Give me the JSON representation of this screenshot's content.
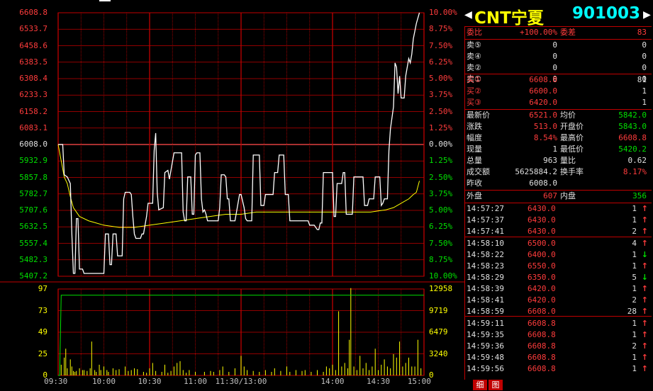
{
  "price_axis": {
    "left_labels": [
      "6608.8",
      "6533.7",
      "6458.6",
      "6383.5",
      "6308.4",
      "6233.3",
      "6158.2",
      "6083.1",
      "6008.0",
      "5932.9",
      "5857.8",
      "5782.7",
      "5707.6",
      "5632.5",
      "5557.4",
      "5482.3",
      "5407.2"
    ],
    "right_labels": [
      "10.00%",
      "8.75%",
      "7.50%",
      "6.25%",
      "5.00%",
      "3.75%",
      "2.50%",
      "1.25%",
      "0.00%",
      "1.25%",
      "2.50%",
      "3.75%",
      "5.00%",
      "6.25%",
      "7.50%",
      "8.75%",
      "10.00%"
    ]
  },
  "volume_axis": {
    "left_labels": [
      "97",
      "73",
      "49",
      "25",
      "0"
    ],
    "right_labels": [
      "12958",
      "9719",
      "6479",
      "3240",
      "0"
    ]
  },
  "time_axis": {
    "labels": [
      "09:30",
      "10:00",
      "10:30",
      "11:00",
      "11:30/13:00",
      "14:00",
      "14:30",
      "15:00"
    ]
  },
  "colors": {
    "up": "#ff3c3c",
    "down": "#00e000",
    "grid": "#c00000",
    "price_line": "#ffffff",
    "avg_line": "#ffff00",
    "neutral": "#e0e0e0",
    "title": "#ffff00",
    "code": "#00ffff"
  },
  "chart_data": {
    "type": "line",
    "title": "",
    "pre_close": 6008.0,
    "ylim": [
      5407.2,
      6608.8
    ],
    "time_domain_minutes": [
      0,
      240
    ],
    "price_series": [
      [
        0,
        6008
      ],
      [
        3,
        6008
      ],
      [
        4,
        5870
      ],
      [
        6,
        5860
      ],
      [
        8,
        5830
      ],
      [
        9,
        5600
      ],
      [
        10,
        5420
      ],
      [
        11,
        5420
      ],
      [
        12,
        5670
      ],
      [
        13,
        5670
      ],
      [
        14,
        5440
      ],
      [
        16,
        5440
      ],
      [
        17,
        5420
      ],
      [
        30,
        5420
      ],
      [
        31,
        5600
      ],
      [
        33,
        5600
      ],
      [
        34,
        5460
      ],
      [
        35,
        5460
      ],
      [
        36,
        5600
      ],
      [
        38,
        5600
      ],
      [
        39,
        5500
      ],
      [
        40,
        5500
      ],
      [
        42,
        5500
      ],
      [
        43,
        5760
      ],
      [
        44,
        5790
      ],
      [
        47,
        5790
      ],
      [
        48,
        5780
      ],
      [
        49,
        5680
      ],
      [
        50,
        5600
      ],
      [
        51,
        5580
      ],
      [
        54,
        5580
      ],
      [
        55,
        5600
      ],
      [
        56,
        5600
      ],
      [
        58,
        5680
      ],
      [
        59,
        5740
      ],
      [
        62,
        5740
      ],
      [
        63,
        5980
      ],
      [
        64,
        6060
      ],
      [
        65,
        5790
      ],
      [
        66,
        5710
      ],
      [
        69,
        5720
      ],
      [
        70,
        5880
      ],
      [
        72,
        5890
      ],
      [
        73,
        5850
      ],
      [
        74,
        5890
      ],
      [
        76,
        5970
      ],
      [
        81,
        5970
      ],
      [
        82,
        5700
      ],
      [
        83,
        5660
      ],
      [
        84,
        5660
      ],
      [
        85,
        5860
      ],
      [
        87,
        5860
      ],
      [
        88,
        5690
      ],
      [
        89,
        5690
      ],
      [
        90,
        5960
      ],
      [
        91,
        5970
      ],
      [
        93,
        5970
      ],
      [
        94,
        5760
      ],
      [
        95,
        5700
      ],
      [
        96,
        5710
      ],
      [
        97,
        5690
      ],
      [
        98,
        5660
      ],
      [
        99,
        5660
      ],
      [
        105,
        5660
      ],
      [
        106,
        5720
      ],
      [
        107,
        5870
      ],
      [
        109,
        5870
      ],
      [
        110,
        5860
      ],
      [
        111,
        5760
      ],
      [
        112,
        5760
      ],
      [
        113,
        5660
      ],
      [
        116,
        5660
      ],
      [
        118,
        5740
      ],
      [
        119,
        5780
      ],
      [
        120,
        5780
      ],
      [
        122,
        5720
      ],
      [
        123,
        5670
      ],
      [
        124,
        5660
      ],
      [
        127,
        5660
      ],
      [
        128,
        5960
      ],
      [
        132,
        5960
      ],
      [
        133,
        5730
      ],
      [
        135,
        5730
      ],
      [
        136,
        5780
      ],
      [
        141,
        5780
      ],
      [
        142,
        5880
      ],
      [
        144,
        5880
      ],
      [
        145,
        5960
      ],
      [
        148,
        5960
      ],
      [
        149,
        5780
      ],
      [
        151,
        5780
      ],
      [
        152,
        5660
      ],
      [
        164,
        5660
      ],
      [
        165,
        5640
      ],
      [
        168,
        5640
      ],
      [
        170,
        5620
      ],
      [
        171,
        5620
      ],
      [
        172,
        5650
      ],
      [
        173,
        5650
      ],
      [
        174,
        5880
      ],
      [
        180,
        5880
      ],
      [
        181,
        5680
      ],
      [
        182,
        5680
      ],
      [
        183,
        5830
      ],
      [
        186,
        5830
      ],
      [
        187,
        5880
      ],
      [
        188,
        5880
      ],
      [
        189,
        5690
      ],
      [
        193,
        5690
      ],
      [
        194,
        5860
      ],
      [
        200,
        5860
      ],
      [
        201,
        5730
      ],
      [
        203,
        5730
      ],
      [
        204,
        5760
      ],
      [
        207,
        5760
      ],
      [
        208,
        5860
      ],
      [
        211,
        5860
      ],
      [
        212,
        5730
      ],
      [
        213,
        5740
      ],
      [
        214,
        5760
      ],
      [
        216,
        5760
      ],
      [
        217,
        5980
      ],
      [
        218,
        6080
      ],
      [
        220,
        6180
      ],
      [
        221,
        6380
      ],
      [
        222,
        6360
      ],
      [
        223,
        6240
      ],
      [
        224,
        6320
      ],
      [
        225,
        6220
      ],
      [
        227,
        6220
      ],
      [
        228,
        6320
      ],
      [
        229,
        6360
      ],
      [
        230,
        6400
      ],
      [
        231,
        6380
      ],
      [
        232,
        6420
      ],
      [
        233,
        6490
      ],
      [
        235,
        6560
      ],
      [
        237,
        6609
      ]
    ],
    "avg_series": [
      [
        0,
        6008
      ],
      [
        4,
        5860
      ],
      [
        6,
        5830
      ],
      [
        8,
        5770
      ],
      [
        10,
        5720
      ],
      [
        14,
        5680
      ],
      [
        20,
        5660
      ],
      [
        30,
        5640
      ],
      [
        40,
        5630
      ],
      [
        50,
        5630
      ],
      [
        60,
        5640
      ],
      [
        70,
        5650
      ],
      [
        80,
        5660
      ],
      [
        90,
        5670
      ],
      [
        100,
        5680
      ],
      [
        110,
        5690
      ],
      [
        120,
        5690
      ],
      [
        130,
        5700
      ],
      [
        140,
        5700
      ],
      [
        150,
        5700
      ],
      [
        160,
        5700
      ],
      [
        170,
        5700
      ],
      [
        180,
        5700
      ],
      [
        190,
        5700
      ],
      [
        200,
        5700
      ],
      [
        205,
        5700
      ],
      [
        210,
        5705
      ],
      [
        215,
        5710
      ],
      [
        220,
        5720
      ],
      [
        225,
        5740
      ],
      [
        230,
        5760
      ],
      [
        233,
        5780
      ],
      [
        235,
        5790
      ],
      [
        237,
        5842
      ]
    ],
    "volume_axis_max": 97,
    "cum_volume_line": [
      [
        0,
        0
      ],
      [
        1,
        0
      ],
      [
        2,
        90
      ],
      [
        240,
        90
      ]
    ],
    "volumes": [
      [
        2,
        12
      ],
      [
        4,
        20
      ],
      [
        5,
        30
      ],
      [
        6,
        8
      ],
      [
        8,
        18
      ],
      [
        9,
        10
      ],
      [
        10,
        5
      ],
      [
        11,
        4
      ],
      [
        12,
        5
      ],
      [
        14,
        8
      ],
      [
        16,
        6
      ],
      [
        17,
        6
      ],
      [
        19,
        5
      ],
      [
        21,
        8
      ],
      [
        22,
        38
      ],
      [
        24,
        6
      ],
      [
        25,
        4
      ],
      [
        27,
        12
      ],
      [
        28,
        6
      ],
      [
        30,
        10
      ],
      [
        32,
        6
      ],
      [
        33,
        4
      ],
      [
        36,
        8
      ],
      [
        38,
        6
      ],
      [
        40,
        7
      ],
      [
        44,
        10
      ],
      [
        46,
        5
      ],
      [
        48,
        6
      ],
      [
        50,
        8
      ],
      [
        52,
        7
      ],
      [
        56,
        4
      ],
      [
        58,
        3
      ],
      [
        60,
        8
      ],
      [
        62,
        14
      ],
      [
        64,
        5
      ],
      [
        68,
        4
      ],
      [
        70,
        12
      ],
      [
        72,
        3
      ],
      [
        74,
        5
      ],
      [
        76,
        10
      ],
      [
        78,
        14
      ],
      [
        80,
        16
      ],
      [
        82,
        6
      ],
      [
        84,
        3
      ],
      [
        86,
        6
      ],
      [
        90,
        4
      ],
      [
        96,
        4
      ],
      [
        100,
        5
      ],
      [
        102,
        4
      ],
      [
        106,
        6
      ],
      [
        108,
        10
      ],
      [
        112,
        4
      ],
      [
        116,
        8
      ],
      [
        120,
        22
      ],
      [
        122,
        10
      ],
      [
        124,
        6
      ],
      [
        128,
        5
      ],
      [
        132,
        4
      ],
      [
        136,
        6
      ],
      [
        140,
        4
      ],
      [
        142,
        8
      ],
      [
        146,
        5
      ],
      [
        150,
        10
      ],
      [
        152,
        4
      ],
      [
        156,
        6
      ],
      [
        160,
        5
      ],
      [
        162,
        6
      ],
      [
        166,
        4
      ],
      [
        170,
        6
      ],
      [
        174,
        4
      ],
      [
        176,
        10
      ],
      [
        178,
        8
      ],
      [
        180,
        12
      ],
      [
        182,
        6
      ],
      [
        184,
        72
      ],
      [
        186,
        10
      ],
      [
        188,
        14
      ],
      [
        190,
        8
      ],
      [
        191,
        40
      ],
      [
        192,
        98
      ],
      [
        194,
        10
      ],
      [
        196,
        6
      ],
      [
        198,
        22
      ],
      [
        200,
        8
      ],
      [
        202,
        14
      ],
      [
        204,
        6
      ],
      [
        206,
        10
      ],
      [
        208,
        30
      ],
      [
        210,
        6
      ],
      [
        212,
        12
      ],
      [
        214,
        18
      ],
      [
        216,
        10
      ],
      [
        218,
        8
      ],
      [
        220,
        24
      ],
      [
        222,
        20
      ],
      [
        224,
        38
      ],
      [
        226,
        10
      ],
      [
        228,
        14
      ],
      [
        230,
        20
      ],
      [
        232,
        10
      ],
      [
        234,
        10
      ],
      [
        236,
        40
      ],
      [
        238,
        8
      ]
    ]
  },
  "panel": {
    "title": "CNT宁夏",
    "code": "901003",
    "order_ratio": {
      "label1": "委比",
      "value1": "+100.00%",
      "label2": "委差",
      "value2": "83"
    },
    "asks": [
      {
        "label": "卖⑤",
        "price": "0",
        "vol": "0"
      },
      {
        "label": "卖④",
        "price": "0",
        "vol": "0"
      },
      {
        "label": "卖②",
        "price": "0",
        "vol": "0"
      },
      {
        "label": "卖①",
        "price": "0",
        "vol": "0"
      }
    ],
    "bids": [
      {
        "label": "买①",
        "price": "6608.8",
        "vol": "81"
      },
      {
        "label": "买②",
        "price": "6600.0",
        "vol": "1"
      },
      {
        "label": "买③",
        "price": "6420.0",
        "vol": "1"
      }
    ],
    "stats": [
      {
        "l1": "最新价",
        "v1": "6521.0",
        "l2": "均价",
        "v2": "5842.0"
      },
      {
        "l1": "涨跌",
        "v1": "513.0",
        "l2": "开盘价",
        "v2": "5843.0"
      },
      {
        "l1": "幅度",
        "v1": "8.54%",
        "l2": "最高价",
        "v2": "6608.8"
      },
      {
        "l1": "现量",
        "v1": "1",
        "l2": "最低价",
        "v2": "5420.2"
      },
      {
        "l1": "总量",
        "v1": "963",
        "l2": "量比",
        "v2": "0.62"
      },
      {
        "l1": "成交额",
        "v1": "5625884.2",
        "l2": "换手率",
        "v2": "8.17%"
      }
    ],
    "prev_close": {
      "label": "昨收",
      "value": "6008.0"
    },
    "outer_inner": {
      "l1": "外盘",
      "v1": "607",
      "l2": "内盘",
      "v2": "356"
    },
    "ticks": [
      {
        "time": "14:57:27",
        "price": "6430.0",
        "vol": "1",
        "dir": "↑",
        "dircolor": "#ff3c3c"
      },
      {
        "time": "14:57:37",
        "price": "6430.0",
        "vol": "1",
        "dir": "↑",
        "dircolor": "#ff3c3c"
      },
      {
        "time": "14:57:41",
        "price": "6430.0",
        "vol": "2",
        "dir": "↑",
        "dircolor": "#ff3c3c"
      },
      {
        "time": "14:58:10",
        "price": "6500.0",
        "vol": "4",
        "dir": "↑",
        "dircolor": "#ff3c3c"
      },
      {
        "time": "14:58:22",
        "price": "6400.0",
        "vol": "1",
        "dir": "↓",
        "dircolor": "#00e000"
      },
      {
        "time": "14:58:23",
        "price": "6550.0",
        "vol": "1",
        "dir": "↑",
        "dircolor": "#ff3c3c"
      },
      {
        "time": "14:58:29",
        "price": "6350.0",
        "vol": "5",
        "dir": "↓",
        "dircolor": "#00e000"
      },
      {
        "time": "14:58:39",
        "price": "6420.0",
        "vol": "1",
        "dir": "↑",
        "dircolor": "#ff3c3c"
      },
      {
        "time": "14:58:41",
        "price": "6420.0",
        "vol": "2",
        "dir": "↑",
        "dircolor": "#ff3c3c"
      },
      {
        "time": "14:58:59",
        "price": "6608.0",
        "vol": "28",
        "dir": "↑",
        "dircolor": "#ff3c3c"
      },
      {
        "time": "14:59:11",
        "price": "6608.8",
        "vol": "1",
        "dir": "↑",
        "dircolor": "#ff3c3c"
      },
      {
        "time": "14:59:35",
        "price": "6608.8",
        "vol": "1",
        "dir": "↑",
        "dircolor": "#ff3c3c"
      },
      {
        "time": "14:59:36",
        "price": "6608.8",
        "vol": "2",
        "dir": "↑",
        "dircolor": "#ff3c3c"
      },
      {
        "time": "14:59:48",
        "price": "6608.8",
        "vol": "1",
        "dir": "↑",
        "dircolor": "#ff3c3c"
      },
      {
        "time": "14:59:56",
        "price": "6608.8",
        "vol": "1",
        "dir": "↑",
        "dircolor": "#ff3c3c"
      }
    ],
    "bottom_tabs": [
      "细",
      "图"
    ]
  }
}
